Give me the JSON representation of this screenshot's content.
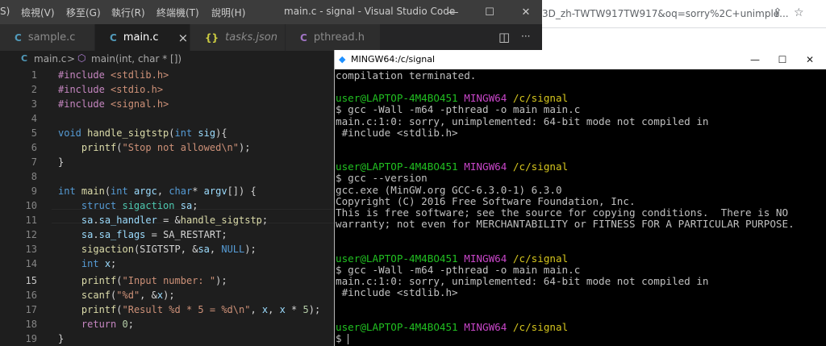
{
  "vscode": {
    "title": "main.c - signal - Visual Studio Code",
    "menu": [
      "S)",
      "檢視(V)",
      "移至(G)",
      "執行(R)",
      "終端機(T)",
      "說明(H)"
    ],
    "window_buttons": {
      "minimize": "—",
      "maximize": "☐",
      "close": "✕"
    },
    "tabs": [
      {
        "icon": "C",
        "label": "sample.c"
      },
      {
        "icon": "C",
        "label": "main.c",
        "close": "×"
      },
      {
        "icon": "{}",
        "label": "tasks.json"
      },
      {
        "icon": "C",
        "label": "pthread.h"
      }
    ],
    "split_icon": "◫",
    "more_icon": "···",
    "breadcrumb": {
      "file": "main.c",
      "sep": ">",
      "symbol": "main(int, char * [])"
    },
    "line_numbers": [
      "1",
      "2",
      "3",
      "4",
      "5",
      "6",
      "7",
      "8",
      "9",
      "10",
      "11",
      "12",
      "13",
      "14",
      "15",
      "16",
      "17",
      "18",
      "19"
    ],
    "code": {
      "l1": {
        "a": "#include ",
        "b": "<stdlib.h>"
      },
      "l2": {
        "a": "#include ",
        "b": "<stdio.h>"
      },
      "l3": {
        "a": "#include ",
        "b": "<signal.h>"
      },
      "l5": {
        "a": "void ",
        "b": "handle_sigtstp",
        "c": "(",
        "d": "int ",
        "e": "sig",
        "f": "){"
      },
      "l6": {
        "a": "    ",
        "b": "printf",
        "c": "(",
        "d": "\"Stop not allowed\\n\"",
        "e": ");"
      },
      "l7": {
        "a": "}"
      },
      "l9": {
        "a": "int ",
        "b": "main",
        "c": "(",
        "d": "int ",
        "e": "argc",
        "f": ", ",
        "g": "char",
        "h": "* ",
        "i": "argv",
        "j": "[]) {"
      },
      "l10": {
        "a": "    ",
        "b": "struct ",
        "c": "sigaction ",
        "d": "sa",
        "e": ";"
      },
      "l11": {
        "a": "    ",
        "b": "sa",
        "c": ".",
        "d": "sa_handler",
        "e": " = &",
        "f": "handle_sigtstp",
        "g": ";"
      },
      "l12": {
        "a": "    ",
        "b": "sa",
        "c": ".",
        "d": "sa_flags",
        "e": " = ",
        "f": "SA_RESTART",
        "g": ";"
      },
      "l13": {
        "a": "    ",
        "b": "sigaction",
        "c": "(",
        "d": "SIGTSTP",
        "e": ", &",
        "f": "sa",
        "g": ", ",
        "h": "NULL",
        "i": ");"
      },
      "l14": {
        "a": "    ",
        "b": "int ",
        "c": "x",
        "d": ";"
      },
      "l15": {
        "a": "    ",
        "b": "printf",
        "c": "(",
        "d": "\"Input number: \"",
        "e": ");"
      },
      "l16": {
        "a": "    ",
        "b": "scanf",
        "c": "(",
        "d": "\"%d\"",
        "e": ", &",
        "f": "x",
        "g": ");"
      },
      "l17": {
        "a": "    ",
        "b": "printf",
        "c": "(",
        "d": "\"Result %d * 5 = %d\\n\"",
        "e": ", ",
        "f": "x",
        "g": ", ",
        "h": "x",
        "i": " * ",
        "j": "5",
        "k": ");"
      },
      "l18": {
        "a": "    ",
        "b": "return ",
        "c": "0",
        "d": ";"
      },
      "l19": {
        "a": "}"
      }
    }
  },
  "browser": {
    "url": "3D_zh-TWTW917TW917&oq=sorry%2C+unimple...",
    "share_icon": "⇪",
    "star_icon": "☆"
  },
  "terminal": {
    "title": "MINGW64:/c/signal",
    "window_buttons": {
      "minimize": "—",
      "maximize": "☐",
      "close": "✕"
    },
    "prompt": {
      "user": "user@LAPTOP-4M4BO451",
      "host": "MINGW64",
      "path": "/c/signal"
    },
    "lines": {
      "t1": "compilation terminated.",
      "t3": "$ gcc -Wall -m64 -pthread -o main main.c",
      "t4": "main.c:1:0: sorry, unimplemented: 64-bit mode not compiled in",
      "t5": " #include <stdlib.h>",
      "t8": "$ gcc --version",
      "t9": "gcc.exe (MinGW.org GCC-6.3.0-1) 6.3.0",
      "t10": "Copyright (C) 2016 Free Software Foundation, Inc.",
      "t11": "This is free software; see the source for copying conditions.  There is NO",
      "t12": "warranty; not even for MERCHANTABILITY or FITNESS FOR A PARTICULAR PURPOSE.",
      "t15": "$ gcc -Wall -m64 -pthread -o main main.c",
      "t16": "main.c:1:0: sorry, unimplemented: 64-bit mode not compiled in",
      "t17": " #include <stdlib.h>",
      "t20": "$ "
    }
  }
}
